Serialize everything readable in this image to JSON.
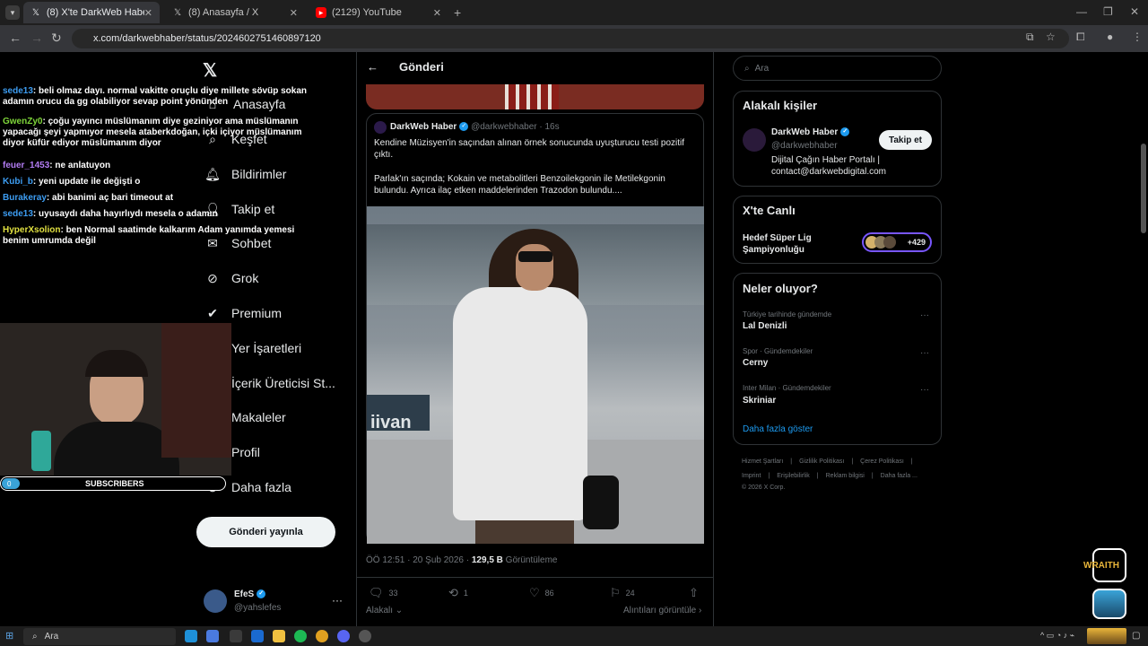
{
  "browser": {
    "tabs": [
      {
        "title": "(8) X'te DarkWeb Haber: \"Kendi",
        "icon": "x-icon"
      },
      {
        "title": "(8) Anasayfa / X",
        "icon": "x-icon"
      },
      {
        "title": "(2129) YouTube",
        "icon": "youtube-icon"
      }
    ],
    "url": "x.com/darkwebhaber/status/2024602751460897120"
  },
  "chat": [
    {
      "user": "sede13",
      "msg": ": beli olmaz dayı. normal vakitte oruçlu diye millete sövüp sokan adamın orucu da gg olabiliyor sevap point yönünden",
      "color": "#3d9df2"
    },
    {
      "user": "GwenZy0",
      "msg": ": çoğu yayıncı müslümanım diye geziniyor ama müslümanın yapacağı şeyi yapmıyor mesela ataberkdoğan, içki içiyor müslümanım diyor küfür ediyor müslümanım diyor",
      "color": "#7fd63a"
    },
    {
      "user": "feuer_1453",
      "msg": ": ne anlatuyon",
      "color": "#b27cf2"
    },
    {
      "user": "Kubi_b",
      "msg": ": yeni update ile değişti o",
      "color": "#3d9df2"
    },
    {
      "user": "Burakeray",
      "msg": ": abi banimi aç bari timeout at",
      "color": "#3d9df2"
    },
    {
      "user": "sede13",
      "msg": ": uyusaydı daha hayırlıydı mesela o adamın",
      "color": "#3d9df2"
    },
    {
      "user": "HyperXsolion",
      "msg": ": ben Normal saatimde kalkarım Adam yanımda yemesi benim umrumda değil",
      "color": "#e0e040"
    }
  ],
  "subscribers": {
    "count": "0",
    "label": "SUBSCRIBERS"
  },
  "nav": {
    "items": [
      "Anasayfa",
      "Keşfet",
      "Bildirimler",
      "Takip et",
      "Sohbet",
      "Grok",
      "Premium",
      "Yer İşaretleri",
      "İçerik Üreticisi St...",
      "Makaleler",
      "Profil",
      "Daha fazla"
    ],
    "post_button": "Gönderi yayınla",
    "user_name": "EfeS",
    "user_handle": "@yahslefes"
  },
  "post": {
    "header": "Gönderi",
    "quote_author": "DarkWeb Haber",
    "quote_handle": "@darkwebhaber",
    "quote_time": "· 16s",
    "quote_text1": "Kendine Müzisyen'in saçından alınan örnek sonucunda uyuşturucu testi pozitif çıktı.",
    "quote_text2": "Parlak'ın saçında; Kokain ve metabolitleri Benzoilekgonin ile Metilekgonin bulundu. Ayrıca ilaç etken maddelerinden Trazodon bulundu....",
    "timestamp": "ÖÖ 12:51 · 20 Şub 2026 ·",
    "views_count": "129,5 B",
    "views_label": "Görüntüleme",
    "replies": "33",
    "reposts": "1",
    "likes": "86",
    "bookmarks": "24",
    "related": "Alakalı",
    "quotes_link": "Alıntıları görüntüle"
  },
  "sidebar": {
    "search_placeholder": "Ara",
    "related_title": "Alakalı kişiler",
    "person_name": "DarkWeb Haber",
    "person_handle": "@darkwebhaber",
    "person_bio": "Dijital Çağın Haber Portalı | contact@darkwebdigital.com",
    "follow_label": "Takip et",
    "live_title": "X'te Canlı",
    "live_event": "Hedef Süper Lig Şampiyonluğu",
    "live_count": "+429",
    "trends_title": "Neler oluyor?",
    "trends": [
      {
        "category": "Türkiye tarihinde gündemde",
        "name": "Lal Denizli"
      },
      {
        "category": "Spor · Gündemdekiler",
        "name": "Cerny"
      },
      {
        "category": "Inter Milan · Gündemdekiler",
        "name": "Skriniar"
      }
    ],
    "show_more": "Daha fazla göster",
    "footer_row1": [
      "Hizmet Şartları",
      "|",
      "Gizlilik Politikası",
      "|",
      "Çerez Politikası",
      "|"
    ],
    "footer_row2": [
      "Imprint",
      "|",
      "Erişilebilirlik",
      "|",
      "Reklam bilgisi",
      "|",
      "Daha fazla ..."
    ],
    "copyright": "© 2026 X Corp."
  },
  "overlay": {
    "wraith": "WRAITH"
  },
  "taskbar": {
    "search_placeholder": "Ara"
  },
  "colors": {
    "accent": "#1d9bf0",
    "bg": "#000000",
    "border": "#2f3336"
  }
}
